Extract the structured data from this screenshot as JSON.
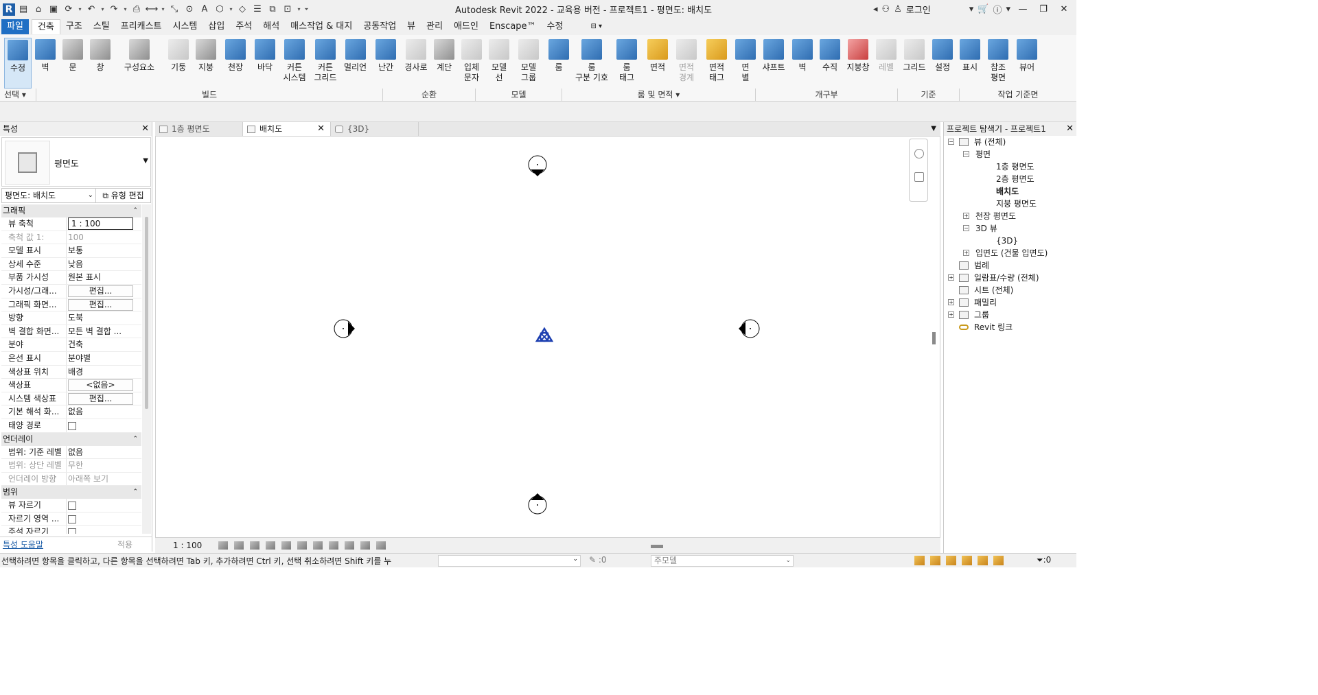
{
  "app": {
    "title": "Autodesk Revit 2022 - 교육용 버전 - 프로젝트1 - 평면도: 배치도",
    "logo": "R",
    "login": "로그인"
  },
  "quick_access": [
    "open-icon",
    "save-icon",
    "sync-icon",
    "undo-icon",
    "redo-icon",
    "print-icon",
    "measure-icon",
    "dimension-icon",
    "tag-icon",
    "text-icon",
    "3d-view-icon",
    "section-icon",
    "thin-lines-icon",
    "close-hidden-icon",
    "switch-windows-icon",
    "customize-icon"
  ],
  "menu_tabs": [
    "파일",
    "건축",
    "구조",
    "스틸",
    "프리캐스트",
    "시스템",
    "삽입",
    "주석",
    "해석",
    "매스작업 & 대지",
    "공동작업",
    "뷰",
    "관리",
    "애드인",
    "Enscape™",
    "수정"
  ],
  "ribbon": {
    "tools": [
      {
        "label": "수정",
        "style": "modify"
      },
      {
        "label": "벽",
        "style": "blue"
      },
      {
        "label": "문",
        "style": "grey"
      },
      {
        "label": "창",
        "style": "grey"
      },
      {
        "label": "구성요소",
        "style": "grey"
      },
      {
        "label": "기둥",
        "style": "light"
      },
      {
        "label": "지붕",
        "style": "grey"
      },
      {
        "label": "천장",
        "style": "blue"
      },
      {
        "label": "바닥",
        "style": "blue"
      },
      {
        "label": "커튼\n시스템",
        "style": "blue"
      },
      {
        "label": "커튼\n그리드",
        "style": "blue"
      },
      {
        "label": "멀리언",
        "style": "blue"
      },
      {
        "label": "난간",
        "style": "blue"
      },
      {
        "label": "경사로",
        "style": "light"
      },
      {
        "label": "계단",
        "style": "grey"
      },
      {
        "label": "입체\n문자",
        "style": "light"
      },
      {
        "label": "모델\n선",
        "style": "light"
      },
      {
        "label": "모델\n그룹",
        "style": "light"
      },
      {
        "label": "룸",
        "style": "blue"
      },
      {
        "label": "룸\n구분 기호",
        "style": "blue"
      },
      {
        "label": "룸\n태그",
        "style": "blue"
      },
      {
        "label": "면적",
        "style": "orange"
      },
      {
        "label": "면적\n경계",
        "style": "disabled"
      },
      {
        "label": "면적\n태그",
        "style": "orange"
      },
      {
        "label": "면\n별",
        "style": "blue"
      },
      {
        "label": "샤프트",
        "style": "blue"
      },
      {
        "label": "벽",
        "style": "blue"
      },
      {
        "label": "수직",
        "style": "blue"
      },
      {
        "label": "지붕창",
        "style": "red"
      },
      {
        "label": "레벨",
        "style": "disabled"
      },
      {
        "label": "그리드",
        "style": "light"
      },
      {
        "label": "설정",
        "style": "blue"
      },
      {
        "label": "표시",
        "style": "blue"
      },
      {
        "label": "참조\n평면",
        "style": "blue"
      },
      {
        "label": "뷰어",
        "style": "blue"
      }
    ],
    "groups": [
      "선택",
      "빌드",
      "순환",
      "모델",
      "룸 및 면적",
      "개구부",
      "기준",
      "작업 기준면"
    ]
  },
  "properties": {
    "header": "특성",
    "type_name": "평면도",
    "view_selector": "평면도: 배치도",
    "edit_type": "유형 편집",
    "sections": [
      {
        "title": "그래픽",
        "rows": [
          {
            "key": "뷰 축척",
            "value": "1 : 100",
            "kind": "input"
          },
          {
            "key": "축척 값    1:",
            "value": "100",
            "kind": "dim"
          },
          {
            "key": "모델 표시",
            "value": "보통"
          },
          {
            "key": "상세 수준",
            "value": "낮음"
          },
          {
            "key": "부품 가시성",
            "value": "원본 표시"
          },
          {
            "key": "가시성/그래...",
            "value": "편집...",
            "kind": "button"
          },
          {
            "key": "그래픽 화면...",
            "value": "편집...",
            "kind": "button"
          },
          {
            "key": "방향",
            "value": "도북"
          },
          {
            "key": "벽 결합 화면...",
            "value": "모든 벽 결합 ..."
          },
          {
            "key": "분야",
            "value": "건축"
          },
          {
            "key": "은선 표시",
            "value": "분야별"
          },
          {
            "key": "색상표 위치",
            "value": "배경"
          },
          {
            "key": "색상표",
            "value": "<없음>",
            "kind": "button"
          },
          {
            "key": "시스템 색상표",
            "value": "편집...",
            "kind": "button"
          },
          {
            "key": "기본 해석 화...",
            "value": "없음"
          },
          {
            "key": "태양 경로",
            "value": "",
            "kind": "checkbox"
          }
        ]
      },
      {
        "title": "언더레이",
        "rows": [
          {
            "key": "범위: 기준 레벨",
            "value": "없음"
          },
          {
            "key": "범위: 상단 레벨",
            "value": "무한",
            "kind": "dim"
          },
          {
            "key": "언더레이 방향",
            "value": "아래쪽 보기",
            "kind": "dim"
          }
        ]
      },
      {
        "title": "범위",
        "rows": [
          {
            "key": "뷰 자르기",
            "value": "",
            "kind": "checkbox"
          },
          {
            "key": "자르기 영역 ...",
            "value": "",
            "kind": "checkbox"
          },
          {
            "key": "주석 자르기",
            "value": "",
            "kind": "checkbox"
          }
        ]
      }
    ],
    "help_link": "특성 도움말",
    "apply": "적용"
  },
  "view_tabs": [
    {
      "label": "1층 평면도",
      "active": false
    },
    {
      "label": "배치도",
      "active": true
    },
    {
      "label": "{3D}",
      "active": false
    }
  ],
  "view_control": {
    "scale": "1 : 100",
    "icons": [
      "detail-level-icon",
      "visual-style-icon",
      "sun-path-icon",
      "shadows-icon",
      "crop-view-icon",
      "show-crop-icon",
      "temporary-hide-icon",
      "reveal-hidden-icon",
      "analytical-model-icon",
      "highlight-displacement-icon",
      "worksharing-icon"
    ]
  },
  "project_browser": {
    "header": "프로젝트 탐색기 - 프로젝트1",
    "nodes": [
      {
        "label": "뷰 (전체)",
        "level": 0,
        "toggle": "−",
        "icon": true
      },
      {
        "label": "평면",
        "level": 1,
        "toggle": "−",
        "icon": false
      },
      {
        "label": "1층 평면도",
        "level": 2,
        "toggle": "",
        "icon": false
      },
      {
        "label": "2층 평면도",
        "level": 2,
        "toggle": "",
        "icon": false
      },
      {
        "label": "배치도",
        "level": 2,
        "toggle": "",
        "icon": false,
        "bold": true
      },
      {
        "label": "지붕 평면도",
        "level": 2,
        "toggle": "",
        "icon": false
      },
      {
        "label": "천장 평면도",
        "level": 1,
        "toggle": "+",
        "icon": false
      },
      {
        "label": "3D 뷰",
        "level": 1,
        "toggle": "−",
        "icon": false
      },
      {
        "label": "{3D}",
        "level": 2,
        "toggle": "",
        "icon": false
      },
      {
        "label": "입면도 (건물 입면도)",
        "level": 1,
        "toggle": "+",
        "icon": false
      },
      {
        "label": "범례",
        "level": 0,
        "toggle": "",
        "icon": true
      },
      {
        "label": "일람표/수량 (전체)",
        "level": 0,
        "toggle": "+",
        "icon": true
      },
      {
        "label": "시트 (전체)",
        "level": 0,
        "toggle": "",
        "icon": true
      },
      {
        "label": "패밀리",
        "level": 0,
        "toggle": "+",
        "icon": true
      },
      {
        "label": "그룹",
        "level": 0,
        "toggle": "+",
        "icon": true
      },
      {
        "label": "Revit 링크",
        "level": 0,
        "toggle": "",
        "icon": true,
        "link": true
      }
    ]
  },
  "status_bar": {
    "message": "선택하려면 항목을 클릭하고, 다른 항목을 선택하려면 Tab 키, 추가하려면 Ctrl 키, 선택 취소하려면 Shift 키를 누",
    "count": ":0",
    "model": "주모델",
    "filter": ":0"
  }
}
